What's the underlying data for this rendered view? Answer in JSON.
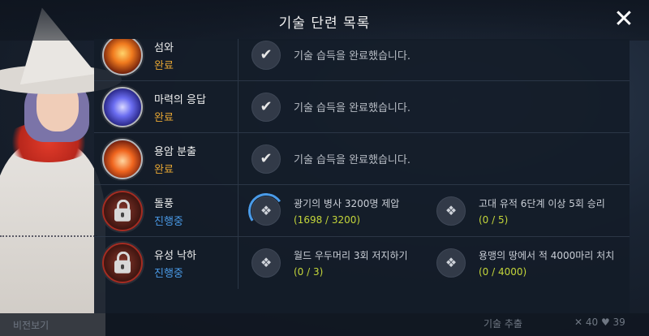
{
  "header": {
    "title": "기술 단련 목록",
    "close_icon": "close-icon"
  },
  "rows": [
    {
      "skill_name": "섬와",
      "status": "완료",
      "status_type": "done",
      "icon": "fire-skill-icon",
      "tasks": [
        {
          "text": "기술 습득을 완료했습니다.",
          "icon": "check-icon"
        }
      ]
    },
    {
      "skill_name": "마력의 응답",
      "status": "완료",
      "status_type": "done",
      "icon": "magic-skill-icon",
      "tasks": [
        {
          "text": "기술 습득을 완료했습니다.",
          "icon": "check-icon"
        }
      ]
    },
    {
      "skill_name": "용암 분출",
      "status": "완료",
      "status_type": "done",
      "icon": "lava-skill-icon",
      "tasks": [
        {
          "text": "기술 습득을 완료했습니다.",
          "icon": "check-icon"
        }
      ]
    },
    {
      "skill_name": "돌풍",
      "status": "진행중",
      "status_type": "progress",
      "icon": "lock-icon",
      "tasks": [
        {
          "text": "광기의 병사 3200명 제압",
          "progress": "(1698 / 3200)",
          "icon": "quest-icon"
        },
        {
          "text": "고대 유적 6단계 이상 5회 승리",
          "progress": "(0 / 5)",
          "icon": "quest-icon"
        }
      ]
    },
    {
      "skill_name": "유성 낙하",
      "status": "진행중",
      "status_type": "progress",
      "icon": "lock-icon",
      "tasks": [
        {
          "text": "월드 우두머리 3회 저지하기",
          "progress": "(0 / 3)",
          "icon": "quest-icon"
        },
        {
          "text": "용맹의 땅에서 적 4000마리 처치",
          "progress": "(0 / 4000)",
          "icon": "quest-icon"
        }
      ]
    }
  ],
  "colors": {
    "done": "#e8a733",
    "progress": "#4a9be8",
    "progress_count": "#c4d63a"
  },
  "bottom": {
    "left_text": "비전보기",
    "mid_text": "기술 추출",
    "right_text": "✕ 40   ♥ 39"
  }
}
